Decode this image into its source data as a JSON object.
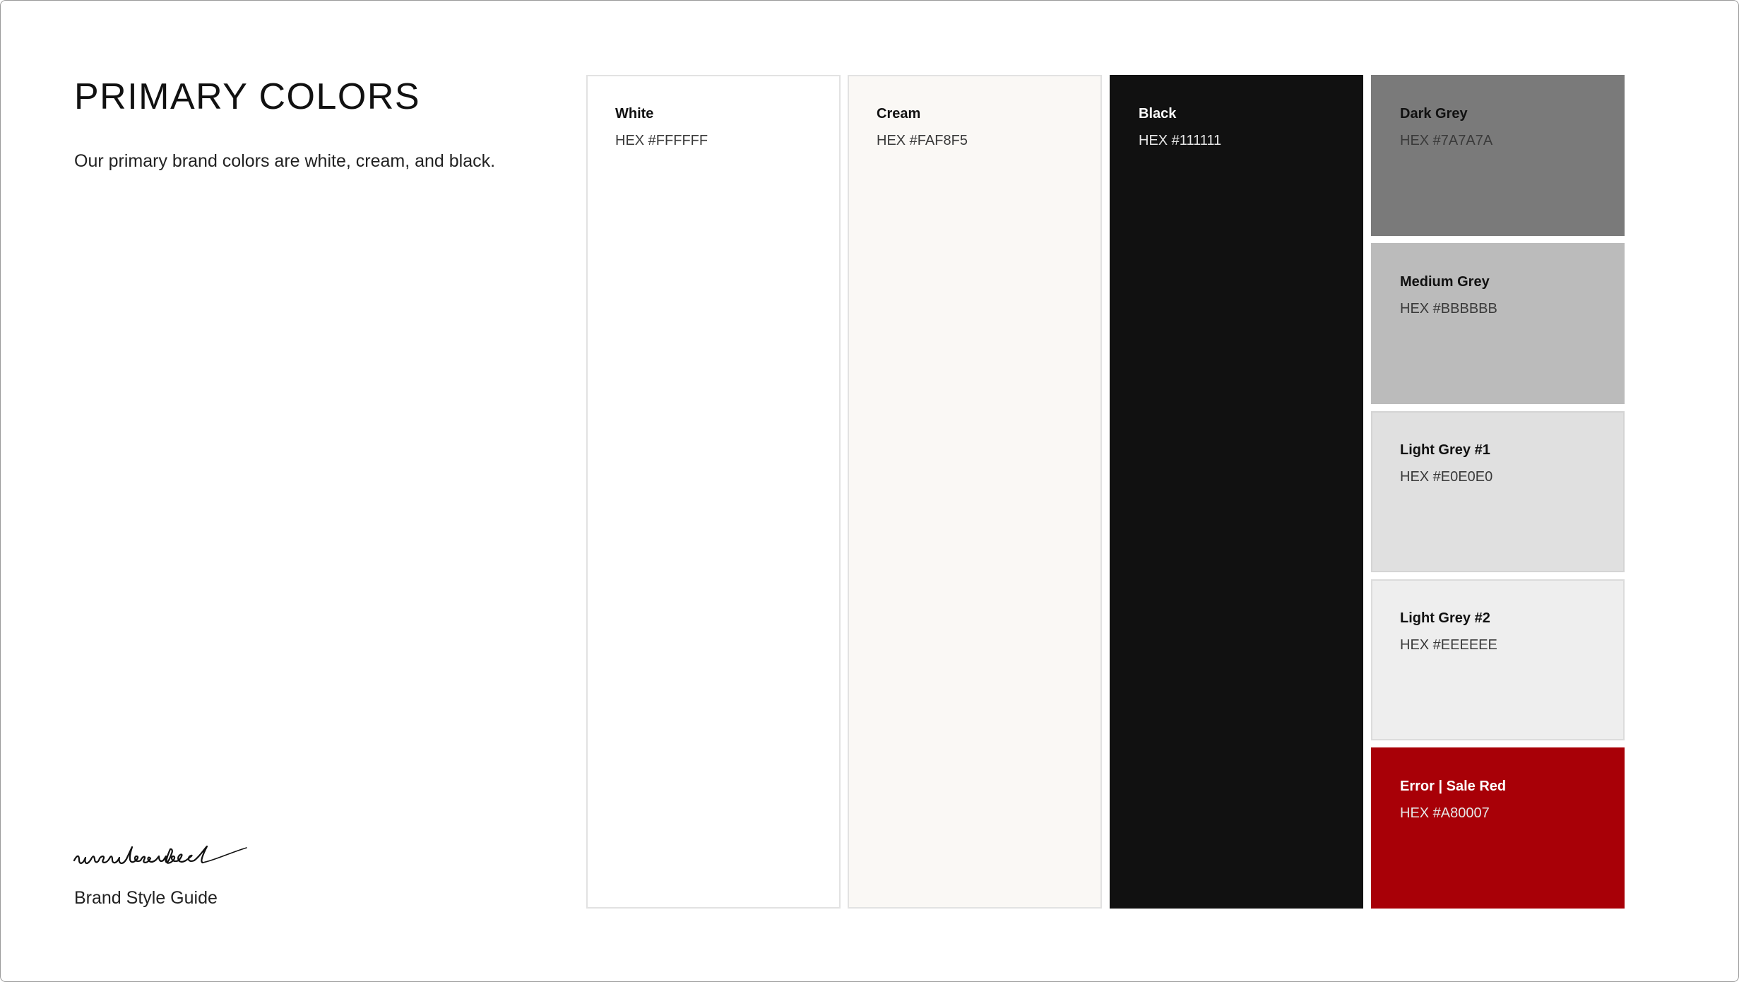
{
  "heading": {
    "title": "PRIMARY COLORS",
    "description": "Our primary brand colors are white, cream, and black."
  },
  "footer": {
    "logo_text": "unsubscribed",
    "guide_label": "Brand Style Guide"
  },
  "swatches": [
    {
      "name": "White",
      "hex_label": "HEX #FFFFFF",
      "color": "#FFFFFF"
    },
    {
      "name": "Cream",
      "hex_label": "HEX #FAF8F5",
      "color": "#FAF8F5"
    },
    {
      "name": "Black",
      "hex_label": "HEX #111111",
      "color": "#111111"
    },
    {
      "name": "Dark Grey",
      "hex_label": "HEX #7A7A7A",
      "color": "#7A7A7A"
    },
    {
      "name": "Medium Grey",
      "hex_label": "HEX #BBBBBB",
      "color": "#BBBBBB"
    },
    {
      "name": "Light Grey #1",
      "hex_label": "HEX #E0E0E0",
      "color": "#E0E0E0"
    },
    {
      "name": "Light Grey #2",
      "hex_label": "HEX #EEEEEE",
      "color": "#EEEEEE"
    },
    {
      "name": "Error | Sale Red",
      "hex_label": "HEX #A80007",
      "color": "#A80007"
    }
  ]
}
